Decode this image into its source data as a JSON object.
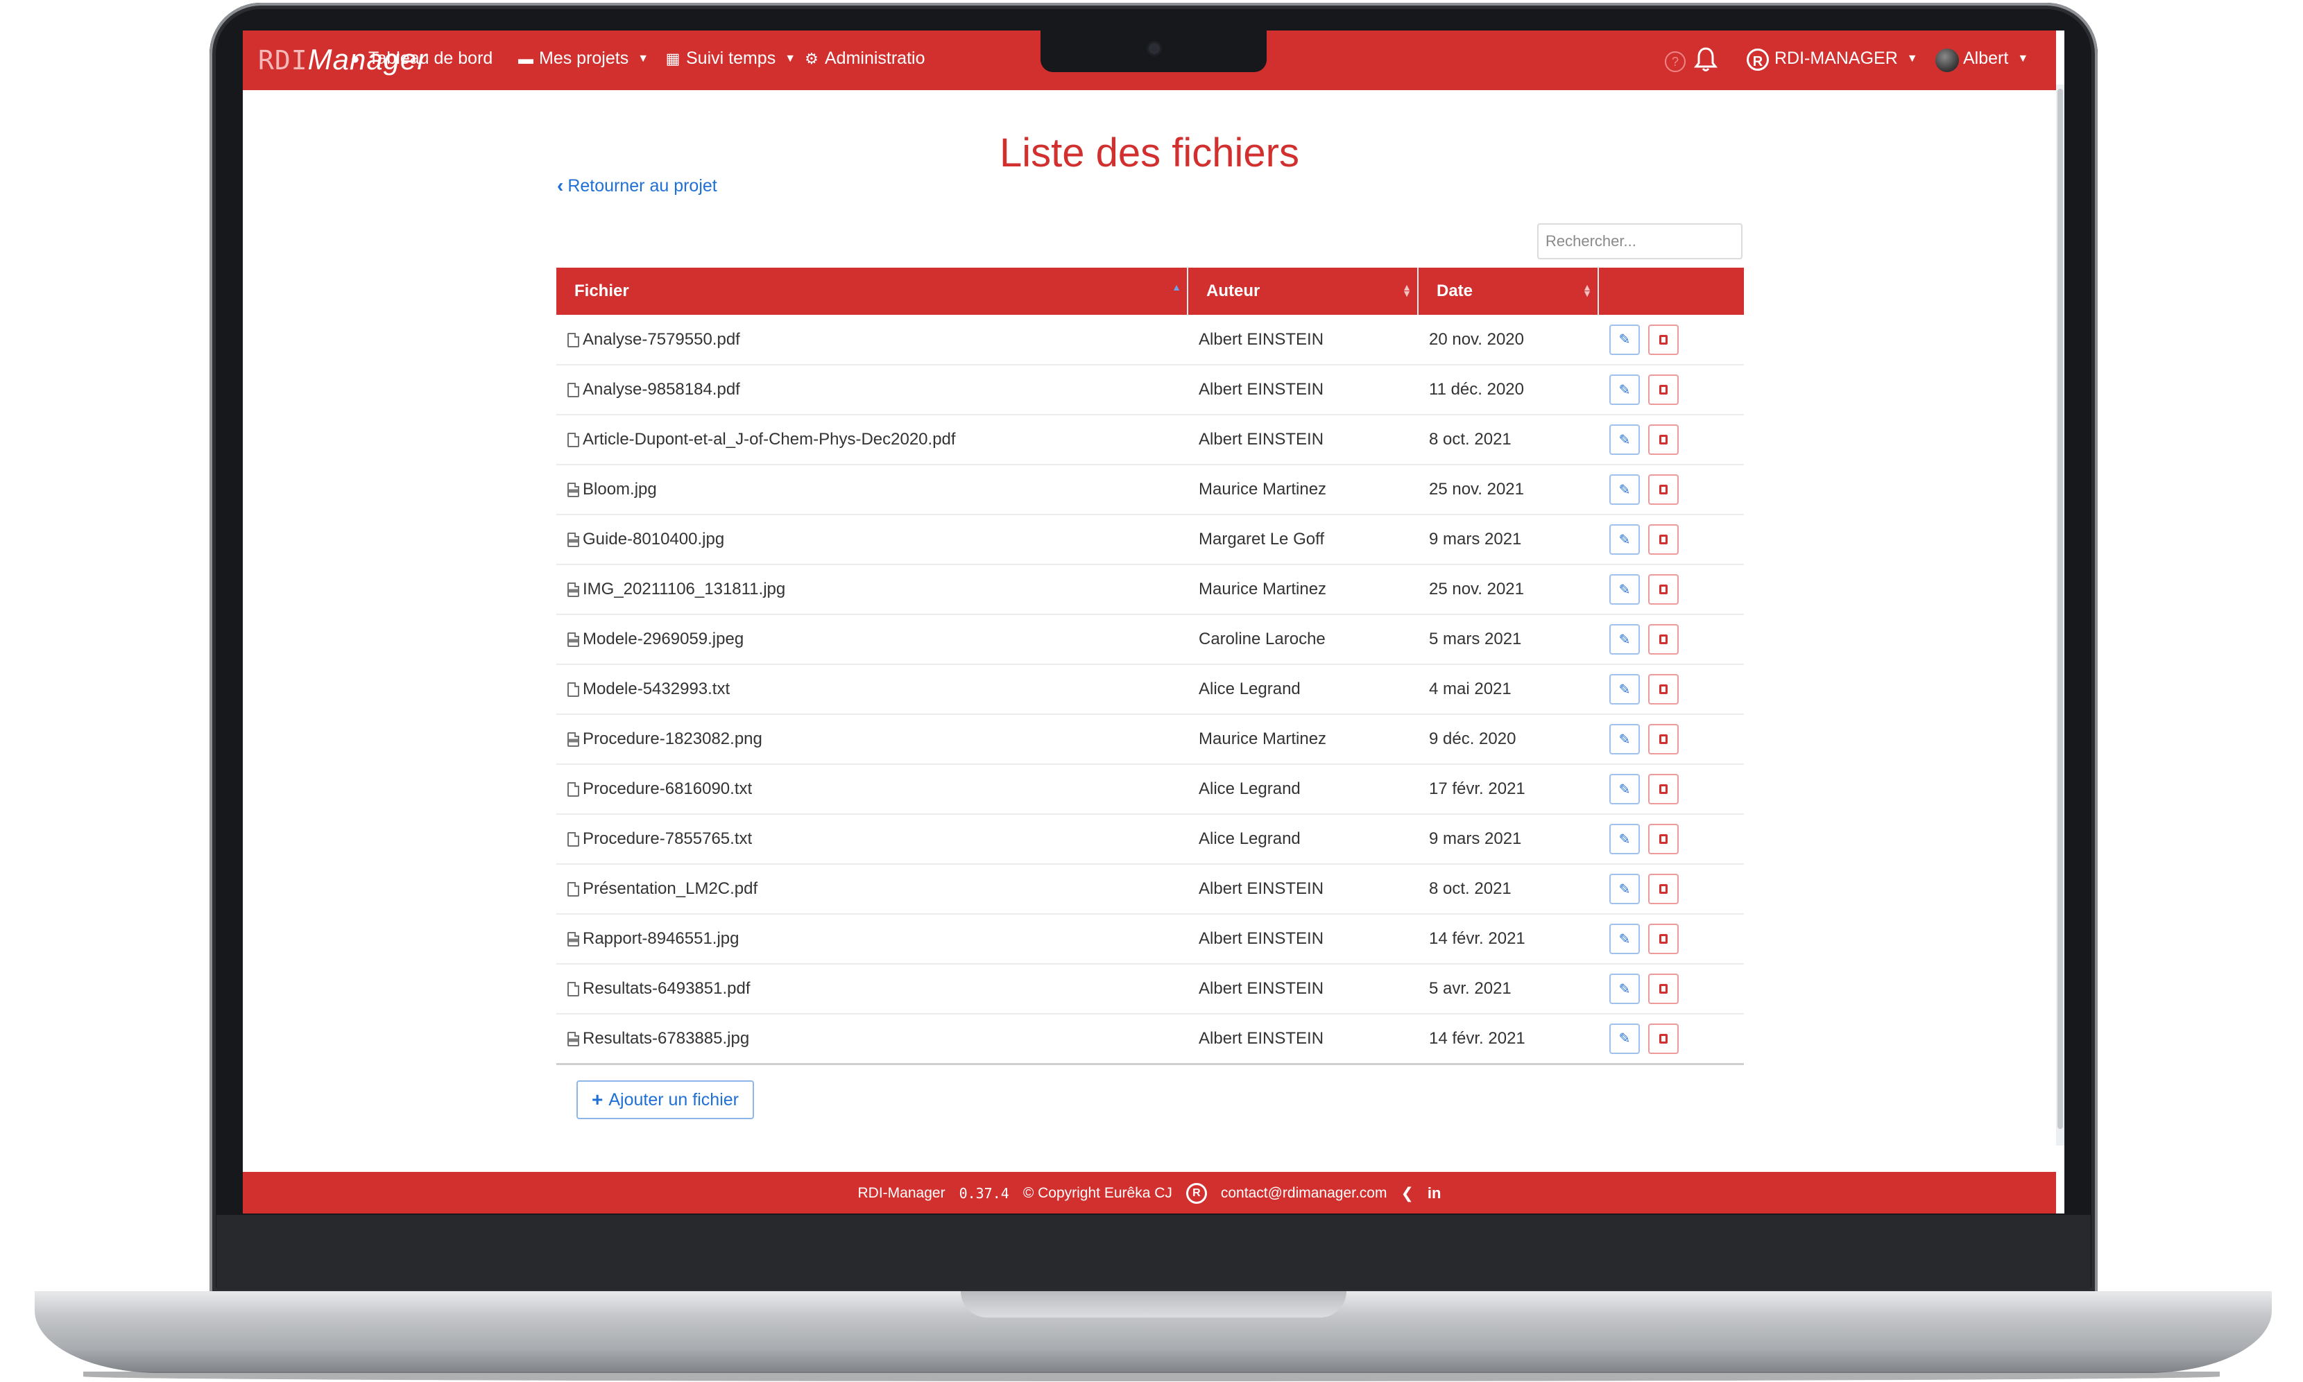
{
  "brand": {
    "rdi": "RDI",
    "manager": "Manager"
  },
  "nav": {
    "dashboard": "Tableau de bord",
    "projects": "Mes projets",
    "time": "Suivi temps",
    "admin": "Administratio",
    "org": "RDI-MANAGER",
    "user": "Albert",
    "help": "?"
  },
  "page": {
    "title": "Liste des fichiers",
    "back": "Retourner au projet",
    "search_placeholder": "Rechercher..."
  },
  "table": {
    "headers": {
      "file": "Fichier",
      "author": "Auteur",
      "date": "Date"
    },
    "rows": [
      {
        "file": "Analyse-7579550.pdf",
        "type": "doc",
        "author": "Albert EINSTEIN",
        "date": "20 nov. 2020"
      },
      {
        "file": "Analyse-9858184.pdf",
        "type": "doc",
        "author": "Albert EINSTEIN",
        "date": "11 déc. 2020"
      },
      {
        "file": "Article-Dupont-et-al_J-of-Chem-Phys-Dec2020.pdf",
        "type": "doc",
        "author": "Albert EINSTEIN",
        "date": "8 oct. 2021"
      },
      {
        "file": "Bloom.jpg",
        "type": "img",
        "author": "Maurice Martinez",
        "date": "25 nov. 2021"
      },
      {
        "file": "Guide-8010400.jpg",
        "type": "img",
        "author": "Margaret Le Goff",
        "date": "9 mars 2021"
      },
      {
        "file": "IMG_20211106_131811.jpg",
        "type": "img",
        "author": "Maurice Martinez",
        "date": "25 nov. 2021"
      },
      {
        "file": "Modele-2969059.jpeg",
        "type": "img",
        "author": "Caroline Laroche",
        "date": "5 mars 2021"
      },
      {
        "file": "Modele-5432993.txt",
        "type": "doc",
        "author": "Alice Legrand",
        "date": "4 mai 2021"
      },
      {
        "file": "Procedure-1823082.png",
        "type": "img",
        "author": "Maurice Martinez",
        "date": "9 déc. 2020"
      },
      {
        "file": "Procedure-6816090.txt",
        "type": "doc",
        "author": "Alice Legrand",
        "date": "17 févr. 2021"
      },
      {
        "file": "Procedure-7855765.txt",
        "type": "doc",
        "author": "Alice Legrand",
        "date": "9 mars 2021"
      },
      {
        "file": "Présentation_LM2C.pdf",
        "type": "doc",
        "author": "Albert EINSTEIN",
        "date": "8 oct. 2021"
      },
      {
        "file": "Rapport-8946551.jpg",
        "type": "img",
        "author": "Albert EINSTEIN",
        "date": "14 févr. 2021"
      },
      {
        "file": "Resultats-6493851.pdf",
        "type": "doc",
        "author": "Albert EINSTEIN",
        "date": "5 avr. 2021"
      },
      {
        "file": "Resultats-6783885.jpg",
        "type": "img",
        "author": "Albert EINSTEIN",
        "date": "14 févr. 2021"
      }
    ]
  },
  "add_button": "Ajouter un fichier",
  "footer": {
    "app": "RDI-Manager",
    "version": "0.37.4",
    "copyright": "© Copyright Eurêka CJ",
    "email": "contact@rdimanager.com",
    "linkedin": "in",
    "org_logo": "R"
  },
  "colors": {
    "primary": "#d22f2f",
    "link": "#1e6fd6"
  }
}
